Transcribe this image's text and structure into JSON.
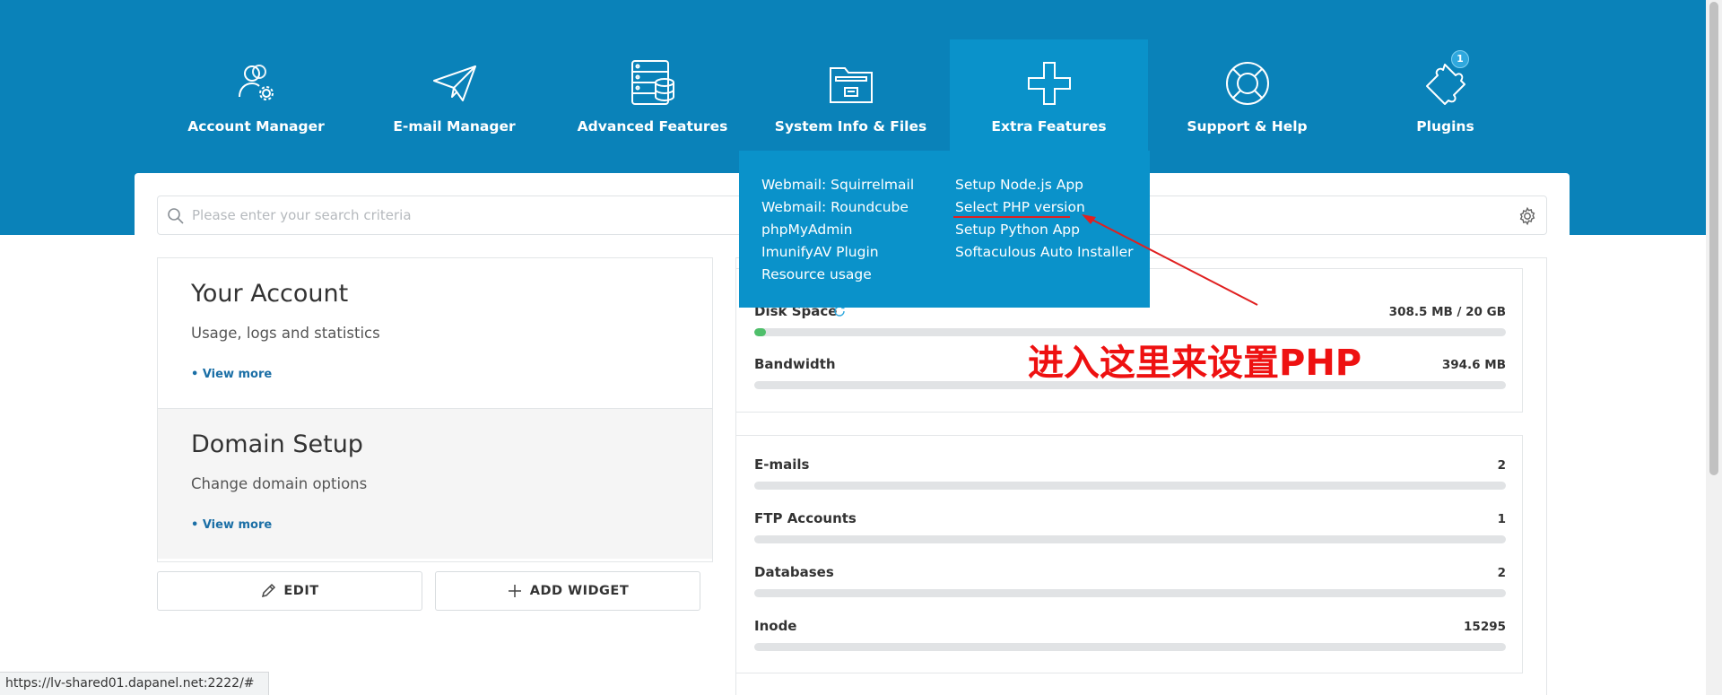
{
  "nav": {
    "items": [
      {
        "label": "Account Manager",
        "icon": "account-settings-icon"
      },
      {
        "label": "E-mail Manager",
        "icon": "paper-plane-icon"
      },
      {
        "label": "Advanced Features",
        "icon": "server-database-icon"
      },
      {
        "label": "System Info & Files",
        "icon": "folder-icon"
      },
      {
        "label": "Extra Features",
        "icon": "plus-icon"
      },
      {
        "label": "Support & Help",
        "icon": "lifebuoy-icon"
      },
      {
        "label": "Plugins",
        "icon": "puzzle-icon",
        "badge": "1"
      }
    ],
    "active": "Extra Features"
  },
  "dropdown": {
    "left": [
      "Webmail: Squirrelmail",
      "Webmail: Roundcube",
      "phpMyAdmin",
      "ImunifyAV Plugin",
      "Resource usage"
    ],
    "right": [
      "Setup Node.js App",
      "Select PHP version",
      "Setup Python App",
      "Softaculous Auto Installer"
    ]
  },
  "search": {
    "placeholder": "Please enter your search criteria"
  },
  "panels": [
    {
      "title": "Your Account",
      "subtitle": "Usage, logs and statistics",
      "more": "• View more"
    },
    {
      "title": "Domain Setup",
      "subtitle": "Change domain options",
      "more": "• View more"
    }
  ],
  "buttons": {
    "edit": "EDIT",
    "add_widget": "ADD WIDGET"
  },
  "usage": [
    {
      "label": "Disk Space",
      "value": "308.5 MB / 20 GB",
      "fraction": 0.015
    },
    {
      "label": "Bandwidth",
      "value": "394.6 MB",
      "fraction": 0
    }
  ],
  "counts": [
    {
      "label": "E-mails",
      "value": "2",
      "fraction": 0
    },
    {
      "label": "FTP Accounts",
      "value": "1",
      "fraction": 0
    },
    {
      "label": "Databases",
      "value": "2",
      "fraction": 0
    },
    {
      "label": "Inode",
      "value": "15295",
      "fraction": 0
    }
  ],
  "annotation": "进入这里来设置PHP",
  "status_url": "https://lv-shared01.dapanel.net:2222/#",
  "colors": {
    "header": "#0a82b9",
    "active": "#0a92ca",
    "accent_red": "#ee1111",
    "bar_fill": "#4fbf6b"
  }
}
